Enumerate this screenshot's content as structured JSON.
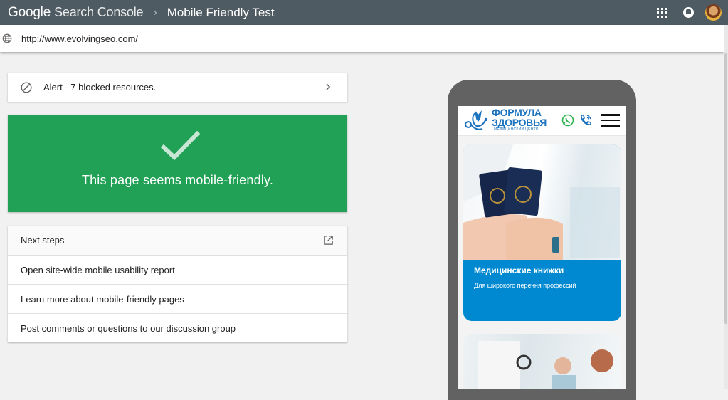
{
  "topbar": {
    "product_google": "Google",
    "product_name": "Search Console",
    "separator": "›",
    "tool_title": "Mobile Friendly Test",
    "icons": [
      "apps-icon",
      "notifications-icon",
      "avatar"
    ]
  },
  "urlbar": {
    "icon": "globe-icon",
    "url": "http://www.evolvingseo.com/"
  },
  "alert": {
    "icon": "blocked-icon",
    "text": "Alert - 7 blocked resources."
  },
  "result": {
    "icon": "check-icon",
    "text": "This page seems mobile-friendly.",
    "color": "#21a155"
  },
  "steps": {
    "header": "Next steps",
    "items": [
      "Open site-wide mobile usability report",
      "Learn more about mobile-friendly pages",
      "Post comments or questions to our discussion group"
    ]
  },
  "preview": {
    "logo_line1": "ФОРМУЛА",
    "logo_line2": "ЗДОРОВЬЯ",
    "logo_sub": "МЕДИЦИНСКИЙ ЦЕНТР",
    "promo_title": "Медицинские книжки",
    "promo_subtitle": "Для широкого перечня профессий",
    "accent": "#0089d1",
    "brand": "#1e73be"
  }
}
